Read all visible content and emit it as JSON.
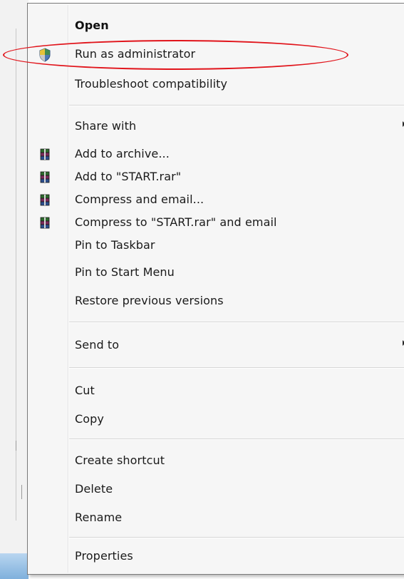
{
  "context_menu": {
    "items": [
      {
        "label": "Open",
        "bold": true,
        "icon": null,
        "submenu": false
      },
      {
        "label": "Run as administrator",
        "bold": false,
        "icon": "uac-shield-icon",
        "submenu": false
      },
      {
        "label": "Troubleshoot compatibility",
        "bold": false,
        "icon": null,
        "submenu": false
      },
      {
        "label": "Share with",
        "bold": false,
        "icon": null,
        "submenu": true
      },
      {
        "label": "Add to archive...",
        "bold": false,
        "icon": "winrar-icon",
        "submenu": false
      },
      {
        "label": "Add to \"START.rar\"",
        "bold": false,
        "icon": "winrar-icon",
        "submenu": false
      },
      {
        "label": "Compress and email...",
        "bold": false,
        "icon": "winrar-icon",
        "submenu": false
      },
      {
        "label": "Compress to \"START.rar\" and email",
        "bold": false,
        "icon": "winrar-icon",
        "submenu": false
      },
      {
        "label": "Pin to Taskbar",
        "bold": false,
        "icon": null,
        "submenu": false
      },
      {
        "label": "Pin to Start Menu",
        "bold": false,
        "icon": null,
        "submenu": false
      },
      {
        "label": "Restore previous versions",
        "bold": false,
        "icon": null,
        "submenu": false
      },
      {
        "label": "Send to",
        "bold": false,
        "icon": null,
        "submenu": true
      },
      {
        "label": "Cut",
        "bold": false,
        "icon": null,
        "submenu": false
      },
      {
        "label": "Copy",
        "bold": false,
        "icon": null,
        "submenu": false
      },
      {
        "label": "Create shortcut",
        "bold": false,
        "icon": null,
        "submenu": false
      },
      {
        "label": "Delete",
        "bold": false,
        "icon": null,
        "submenu": false
      },
      {
        "label": "Rename",
        "bold": false,
        "icon": null,
        "submenu": false
      },
      {
        "label": "Properties",
        "bold": false,
        "icon": null,
        "submenu": false
      }
    ],
    "highlighted_item": "Run as administrator"
  },
  "colors": {
    "menu_background": "#f6f6f6",
    "highlight_annotation": "#e1141b",
    "text": "#1a1a1a"
  }
}
